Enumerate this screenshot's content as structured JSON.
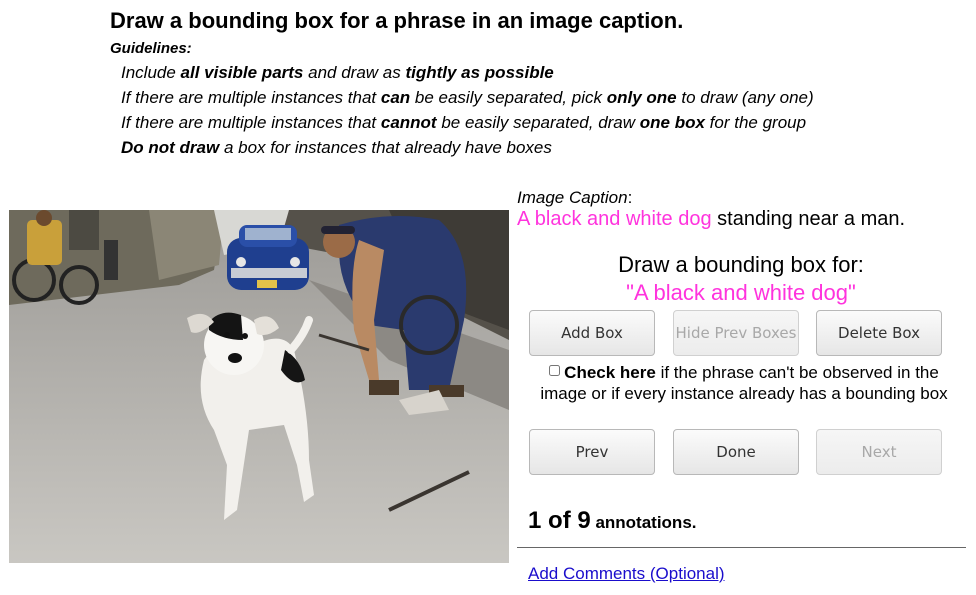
{
  "header": {
    "title": "Draw a bounding box for a phrase in an image caption.",
    "guidelines_label": "Guidelines:"
  },
  "guidelines": [
    [
      {
        "t": "Include ",
        "b": false
      },
      {
        "t": "all visible parts",
        "b": true
      },
      {
        "t": " and draw as ",
        "b": false
      },
      {
        "t": "tightly as possible",
        "b": true
      }
    ],
    [
      {
        "t": "If there are multiple instances that ",
        "b": false
      },
      {
        "t": "can",
        "b": true
      },
      {
        "t": " be easily separated, pick ",
        "b": false
      },
      {
        "t": "only one",
        "b": true
      },
      {
        "t": " to draw (any one)",
        "b": false
      }
    ],
    [
      {
        "t": "If there are multiple instances that ",
        "b": false
      },
      {
        "t": "cannot",
        "b": true
      },
      {
        "t": " be easily separated, draw ",
        "b": false
      },
      {
        "t": "one box",
        "b": true
      },
      {
        "t": " for the group",
        "b": false
      }
    ],
    [
      {
        "t": "Do not draw",
        "b": true
      },
      {
        "t": " a box for instances that already have boxes",
        "b": false
      }
    ]
  ],
  "caption": {
    "label": "Image Caption",
    "label_suffix": ":",
    "phrase": "A black and white dog",
    "rest": " standing near a man."
  },
  "task": {
    "draw_for": "Draw a bounding box for:",
    "phrase_quoted": "\"A black and white dog\""
  },
  "buttons": {
    "add_box": "Add Box",
    "hide_prev": "Hide Prev Boxes",
    "delete_box": "Delete Box",
    "prev": "Prev",
    "done": "Done",
    "next": "Next"
  },
  "checkbox": {
    "bold": "Check here",
    "rest": " if the phrase can't be observed in the image or if every instance already has a bounding box",
    "checked": false
  },
  "progress": {
    "current": "1",
    "of": " of ",
    "total": "9",
    "suffix": " annotations."
  },
  "comments_link": "Add Comments (Optional)",
  "colors": {
    "phrase": "#ff33dd",
    "link": "#1a0dcc"
  }
}
